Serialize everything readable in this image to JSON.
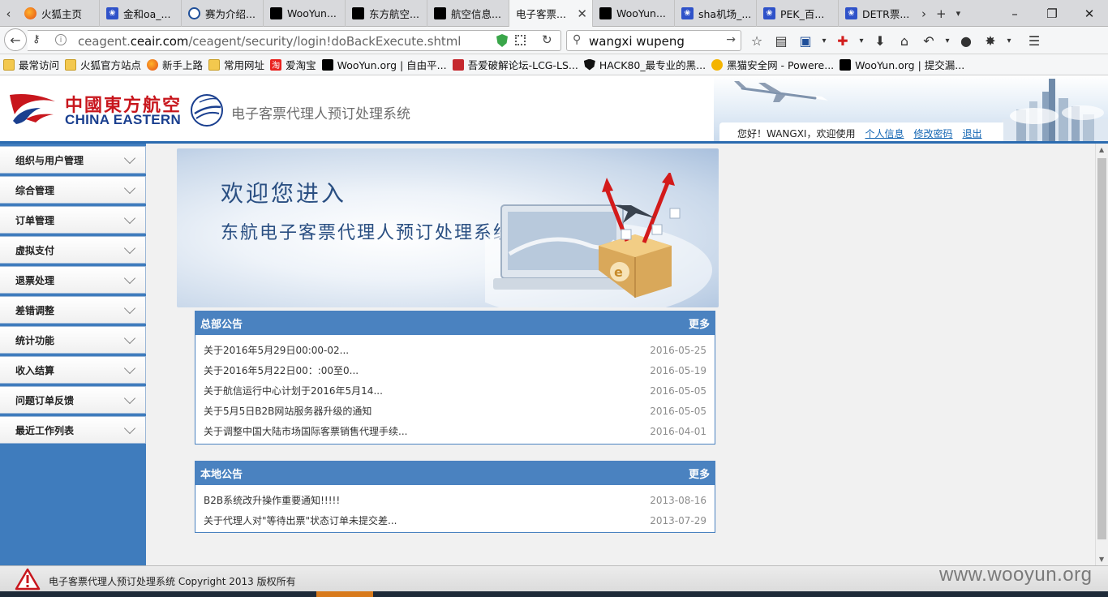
{
  "browser": {
    "tabs": [
      {
        "label": "火狐主页",
        "icon": "firefox-icon"
      },
      {
        "label": "金和oa_...",
        "icon": "paw-icon"
      },
      {
        "label": "赛为介绍...",
        "icon": "globe-icon"
      },
      {
        "label": "WooYun...",
        "icon": "wooyun-icon"
      },
      {
        "label": "东方航空...",
        "icon": "wooyun-icon"
      },
      {
        "label": "航空信息...",
        "icon": "wooyun-icon"
      },
      {
        "label": "电子客票...",
        "icon": "none",
        "active": true
      },
      {
        "label": "WooYun...",
        "icon": "wooyun-icon"
      },
      {
        "label": "sha机场_...",
        "icon": "paw-icon"
      },
      {
        "label": "PEK_百...",
        "icon": "paw-icon"
      },
      {
        "label": "DETR票...",
        "icon": "paw-icon"
      }
    ],
    "url_domain": "ceagent.ceair.com",
    "url_prefix": "ceagent.",
    "url_host": "ceair.com",
    "url_path": "/ceagent/security/login!doBackExecute.shtml",
    "search_value": "wangxi wupeng",
    "bookmarks": [
      {
        "label": "最常访问",
        "icon": "folder"
      },
      {
        "label": "火狐官方站点",
        "icon": "folder"
      },
      {
        "label": "新手上路",
        "icon": "firefox"
      },
      {
        "label": "常用网址",
        "icon": "folder"
      },
      {
        "label": "爱淘宝",
        "icon": "fire"
      },
      {
        "label": "WooYun.org | 自由平...",
        "icon": "wooyun"
      },
      {
        "label": "吾爱破解论坛-LCG-LS...",
        "icon": "lcg"
      },
      {
        "label": "HACK80_最专业的黑...",
        "icon": "shield"
      },
      {
        "label": "黑猫安全网 - Powere...",
        "icon": "cat"
      },
      {
        "label": "WooYun.org | 提交漏...",
        "icon": "wooyun"
      }
    ]
  },
  "header": {
    "brand_cn": "中國東方航空",
    "brand_en": "CHINA EASTERN",
    "system_title": "电子客票代理人预订处理系统",
    "greeting": "您好！WANGXI，欢迎使用",
    "link_profile": "个人信息",
    "link_password": "修改密码",
    "link_logout": "退出"
  },
  "sidebar": {
    "items": [
      {
        "label": "组织与用户管理"
      },
      {
        "label": "综合管理"
      },
      {
        "label": "订单管理"
      },
      {
        "label": "虚拟支付"
      },
      {
        "label": "退票处理"
      },
      {
        "label": "差错调整"
      },
      {
        "label": "统计功能"
      },
      {
        "label": "收入结算"
      },
      {
        "label": "问题订单反馈"
      },
      {
        "label": "最近工作列表"
      }
    ]
  },
  "welcome": {
    "line1": "欢迎您进入",
    "line2": "东航电子客票代理人预订处理系统！"
  },
  "hq_notices": {
    "title": "总部公告",
    "more": "更多",
    "rows": [
      {
        "text": "关于2016年5月29日00:00-02...",
        "date": "2016-05-25"
      },
      {
        "text": "关于2016年5月22日00：:00至0...",
        "date": "2016-05-19"
      },
      {
        "text": "关于航信运行中心计划于2016年5月14...",
        "date": "2016-05-05"
      },
      {
        "text": "关于5月5日B2B网站服务器升级的通知",
        "date": "2016-05-05"
      },
      {
        "text": "关于调整中国大陆市场国际客票销售代理手续...",
        "date": "2016-04-01"
      }
    ]
  },
  "local_notices": {
    "title": "本地公告",
    "more": "更多",
    "rows": [
      {
        "text": "B2B系统改升操作重要通知!!!!!",
        "date": "2013-08-16"
      },
      {
        "text": "关于代理人对\"等待出票\"状态订单未提交差...",
        "date": "2013-07-29"
      }
    ]
  },
  "footer": {
    "copyright": "电子客票代理人预订处理系统 Copyright 2013 版权所有",
    "watermark": "www.wooyun.org"
  },
  "colors": {
    "brand_red": "#c8161d",
    "brand_blue": "#1a3f8f",
    "panel_blue": "#4a82c0",
    "sidebar_blue": "#3f7cbd",
    "link_blue": "#1466b3"
  }
}
